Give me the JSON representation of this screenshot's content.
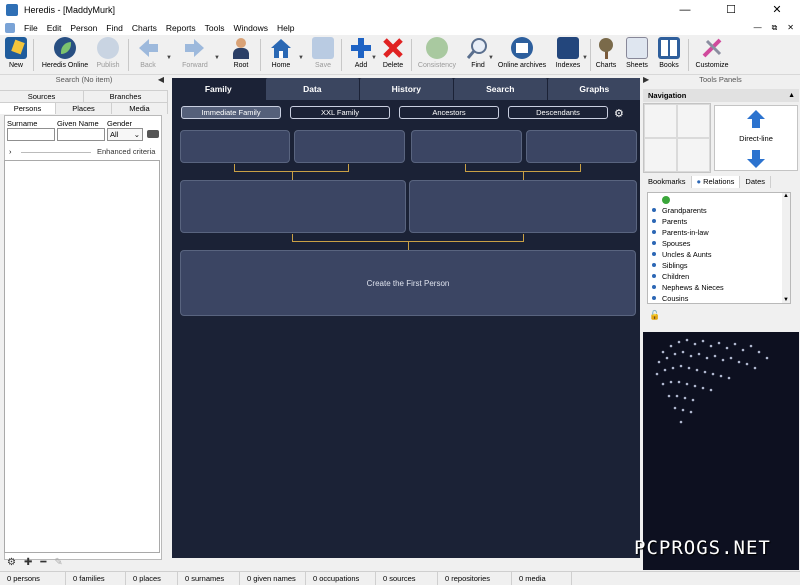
{
  "window": {
    "title": "Heredis - [MaddyMurk]",
    "controls": [
      "—",
      "☐",
      "✕"
    ],
    "mdi_controls": [
      "—",
      "⧉",
      "✕"
    ]
  },
  "menubar": [
    "File",
    "Edit",
    "Person",
    "Find",
    "Charts",
    "Reports",
    "Tools",
    "Windows",
    "Help"
  ],
  "toolbar": {
    "new": "New",
    "heredis_online": "Heredis Online",
    "publish": "Publish",
    "back": "Back",
    "forward": "Forward",
    "root": "Root",
    "home": "Home",
    "save": "Save",
    "add": "Add",
    "delete": "Delete",
    "consistency": "Consistency",
    "find": "Find",
    "online_archives": "Online archives",
    "indexes": "Indexes",
    "charts": "Charts",
    "sheets": "Sheets",
    "books": "Books",
    "customize": "Customize"
  },
  "left_panel": {
    "header": "Search (No item)",
    "tabs_row1": [
      "Sources",
      "Branches"
    ],
    "tabs_row2": [
      "Persons",
      "Places",
      "Media"
    ],
    "labels": {
      "surname": "Surname",
      "given_name": "Given Name",
      "gender": "Gender"
    },
    "gender_value": "All",
    "enhanced_criteria": "Enhanced criteria"
  },
  "center": {
    "tabs": [
      "Family",
      "Data",
      "History",
      "Search",
      "Graphs"
    ],
    "subtabs": [
      "Immediate Family",
      "XXL Family",
      "Ancestors",
      "Descendants"
    ],
    "first_person": "Create the First Person"
  },
  "right_panel": {
    "header": "Tools Panels",
    "navigation": "Navigation",
    "direct_line": "Direct-line",
    "tabs": [
      "Bookmarks",
      "Relations",
      "Dates"
    ],
    "relations": [
      "Grandparents",
      "Parents",
      "Parents-in-law",
      "Spouses",
      "Uncles & Aunts",
      "Siblings",
      "Children",
      "Nephews & Nieces",
      "Cousins"
    ]
  },
  "status_bar": [
    "0 persons",
    "0 families",
    "0 places",
    "0 surnames",
    "0 given names",
    "0 occupations",
    "0 sources",
    "0 repositories",
    "0 media"
  ],
  "watermark": "PCPROGS.NET",
  "colors": {
    "canvas_bg": "#1b2236",
    "person_box": "#3b4563",
    "connector": "#c9a045",
    "accent_blue": "#2c67b5"
  }
}
